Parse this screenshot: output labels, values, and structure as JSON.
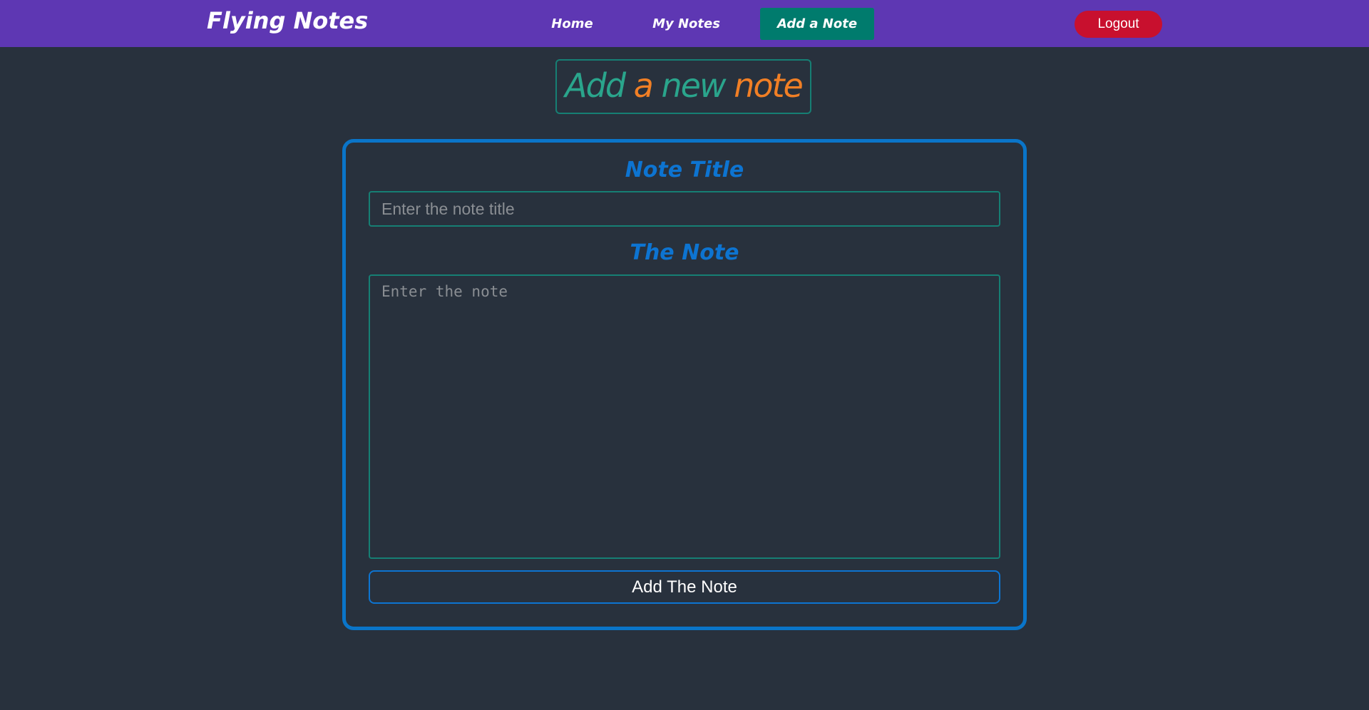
{
  "navbar": {
    "brand": "Flying Notes",
    "links": [
      {
        "label": "Home"
      },
      {
        "label": "My Notes"
      },
      {
        "label": "Add a Note",
        "active": true
      }
    ],
    "logout_label": "Logout"
  },
  "page": {
    "heading": {
      "part1": "Add",
      "part2": "a",
      "part3": "new",
      "part4": "note"
    }
  },
  "form": {
    "title_label": "Note Title",
    "title_placeholder": "Enter the note title",
    "title_value": "",
    "note_label": "The Note",
    "note_placeholder": "Enter the note",
    "note_value": "",
    "submit_label": "Add The Note"
  },
  "colors": {
    "navbar_bg": "#5e37b3",
    "page_bg": "#28313d",
    "active_link_bg": "#007b6d",
    "logout_bg": "#c8102e",
    "heading_teal": "#2aa58c",
    "heading_orange": "#f17f25",
    "form_border": "#0a75c9",
    "field_border": "#167f74",
    "label_blue": "#0d74d1"
  }
}
